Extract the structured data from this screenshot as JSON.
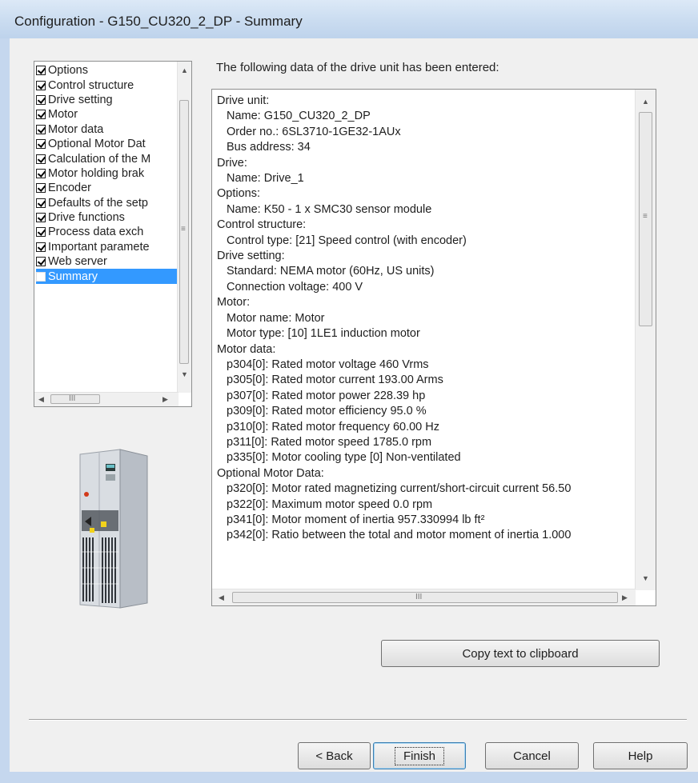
{
  "window": {
    "title": "Configuration - G150_CU320_2_DP - Summary"
  },
  "tree": {
    "items": [
      {
        "label": "Options",
        "checked": true
      },
      {
        "label": "Control structure",
        "checked": true
      },
      {
        "label": "Drive setting",
        "checked": true
      },
      {
        "label": "Motor",
        "checked": true
      },
      {
        "label": "Motor data",
        "checked": true
      },
      {
        "label": "Optional Motor Dat",
        "checked": true
      },
      {
        "label": "Calculation of the M",
        "checked": true
      },
      {
        "label": "Motor holding brak",
        "checked": true
      },
      {
        "label": "Encoder",
        "checked": true
      },
      {
        "label": "Defaults of the setp",
        "checked": true
      },
      {
        "label": "Drive functions",
        "checked": true
      },
      {
        "label": "Process data exch",
        "checked": true
      },
      {
        "label": "Important paramete",
        "checked": true
      },
      {
        "label": "Web server",
        "checked": true
      },
      {
        "label": "Summary",
        "checked": false,
        "selected": true
      }
    ],
    "hscroll_grip": "III"
  },
  "intro": "The following data of the drive unit has been entered:",
  "summary": {
    "lines": [
      {
        "text": "Drive unit:",
        "indent": false
      },
      {
        "text": "Name: G150_CU320_2_DP",
        "indent": true
      },
      {
        "text": "Order no.: 6SL3710-1GE32-1AUx",
        "indent": true
      },
      {
        "text": "Bus address: 34",
        "indent": true
      },
      {
        "text": "Drive:",
        "indent": false
      },
      {
        "text": "Name: Drive_1",
        "indent": true
      },
      {
        "text": "Options:",
        "indent": false
      },
      {
        "text": "Name: K50 - 1 x SMC30 sensor module",
        "indent": true
      },
      {
        "text": "Control structure:",
        "indent": false
      },
      {
        "text": "Control type: [21] Speed control (with encoder)",
        "indent": true
      },
      {
        "text": "Drive setting:",
        "indent": false
      },
      {
        "text": "Standard: NEMA motor (60Hz, US units)",
        "indent": true
      },
      {
        "text": "Connection voltage: 400 V",
        "indent": true
      },
      {
        "text": "Motor:",
        "indent": false
      },
      {
        "text": "Motor name: Motor",
        "indent": true
      },
      {
        "text": "Motor type: [10] 1LE1 induction motor",
        "indent": true
      },
      {
        "text": "Motor data:",
        "indent": false
      },
      {
        "text": "p304[0]: Rated motor voltage 460 Vrms",
        "indent": true
      },
      {
        "text": "p305[0]: Rated motor current 193.00 Arms",
        "indent": true
      },
      {
        "text": "p307[0]: Rated motor power 228.39 hp",
        "indent": true
      },
      {
        "text": "p309[0]: Rated motor efficiency 95.0 %",
        "indent": true
      },
      {
        "text": "p310[0]: Rated motor frequency 60.00 Hz",
        "indent": true
      },
      {
        "text": "p311[0]: Rated motor speed 1785.0 rpm",
        "indent": true
      },
      {
        "text": "p335[0]: Motor cooling type [0] Non-ventilated",
        "indent": true
      },
      {
        "text": "Optional Motor Data:",
        "indent": false
      },
      {
        "text": "p320[0]: Motor rated magnetizing current/short-circuit current 56.50",
        "indent": true
      },
      {
        "text": "p322[0]: Maximum motor speed 0.0 rpm",
        "indent": true
      },
      {
        "text": "p341[0]: Motor moment of inertia 957.330994 lb ft²",
        "indent": true
      },
      {
        "text": "p342[0]: Ratio between the total and motor moment of inertia 1.000",
        "indent": true
      }
    ],
    "hscroll_grip": "III",
    "vscroll_grip": "≡"
  },
  "buttons": {
    "copy": "Copy text to clipboard",
    "back": "< Back",
    "finish": "Finish",
    "cancel": "Cancel",
    "help": "Help"
  },
  "colors": {
    "selection": "#3399ff",
    "titlebar": "#cadcf0"
  }
}
